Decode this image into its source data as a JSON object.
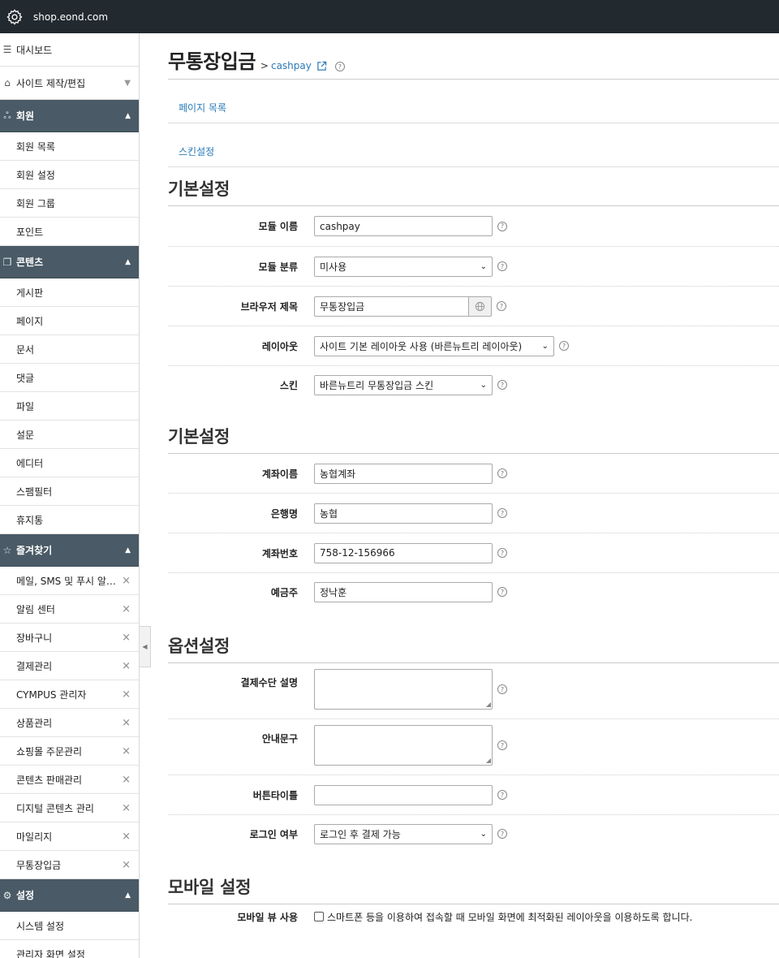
{
  "topbar": {
    "site": "shop.eond.com",
    "icon": "gear-icon"
  },
  "sidebar": {
    "dashboard": "대시보드",
    "site_edit": "사이트 제작/편집",
    "groups": [
      {
        "title": "회원",
        "icon": "users-icon",
        "items": [
          {
            "label": "회원 목록"
          },
          {
            "label": "회원 설정"
          },
          {
            "label": "회원 그룹"
          },
          {
            "label": "포인트"
          }
        ]
      },
      {
        "title": "콘텐츠",
        "icon": "copy-icon",
        "items": [
          {
            "label": "게시판"
          },
          {
            "label": "페이지"
          },
          {
            "label": "문서"
          },
          {
            "label": "댓글"
          },
          {
            "label": "파일"
          },
          {
            "label": "설문"
          },
          {
            "label": "에디터"
          },
          {
            "label": "스팸필터"
          },
          {
            "label": "휴지통"
          }
        ]
      },
      {
        "title": "즐겨찾기",
        "icon": "star-icon",
        "items": [
          {
            "label": "메일, SMS 및 푸시 알림 관리"
          },
          {
            "label": "알림 센터"
          },
          {
            "label": "장바구니"
          },
          {
            "label": "결제관리"
          },
          {
            "label": "CYMPUS 관리자"
          },
          {
            "label": "상품관리"
          },
          {
            "label": "쇼핑몰 주문관리"
          },
          {
            "label": "콘텐츠 판매관리"
          },
          {
            "label": "디지털 콘텐츠 관리"
          },
          {
            "label": "마일리지"
          },
          {
            "label": "무통장입금"
          }
        ]
      },
      {
        "title": "설정",
        "icon": "gear-icon",
        "items": [
          {
            "label": "시스템 설정"
          },
          {
            "label": "관리자 화면 설정"
          }
        ]
      }
    ]
  },
  "page": {
    "title": "무통장입금",
    "crumb_sep": ">",
    "crumb_link": "cashpay",
    "help": "?",
    "links": {
      "page_list": "페이지 목록",
      "skin_settings": "스킨설정"
    }
  },
  "sections": {
    "basic": {
      "title": "기본설정",
      "module_name_label": "모듈 이름",
      "module_name_value": "cashpay",
      "module_category_label": "모듈 분류",
      "module_category_value": "미사용",
      "browser_title_label": "브라우저 제목",
      "browser_title_value": "무통장입금",
      "layout_label": "레이아웃",
      "layout_value": "사이트 기본 레이아웃 사용 (바른뉴트리 레이아웃)",
      "skin_label": "스킨",
      "skin_value": "바른뉴트리 무통장입금 스킨"
    },
    "account": {
      "title": "기본설정",
      "account_name_label": "계좌이름",
      "account_name_value": "농협계좌",
      "bank_label": "은행명",
      "bank_value": "농협",
      "account_no_label": "계좌번호",
      "account_no_value": "758-12-156966",
      "holder_label": "예금주",
      "holder_value": "정낙훈"
    },
    "options": {
      "title": "옵션설정",
      "pay_desc_label": "결제수단 설명",
      "guide_label": "안내문구",
      "button_title_label": "버튼타이틀",
      "login_label": "로그인 여부",
      "login_value": "로그인 후 결제 가능"
    },
    "mobile": {
      "title": "모바일 설정",
      "use_label": "모바일 뷰 사용",
      "use_text": "스마트폰 등을 이용하여 접속할 때 모바일 화면에 최적화된 레이아웃을 이용하도록 합니다."
    }
  }
}
